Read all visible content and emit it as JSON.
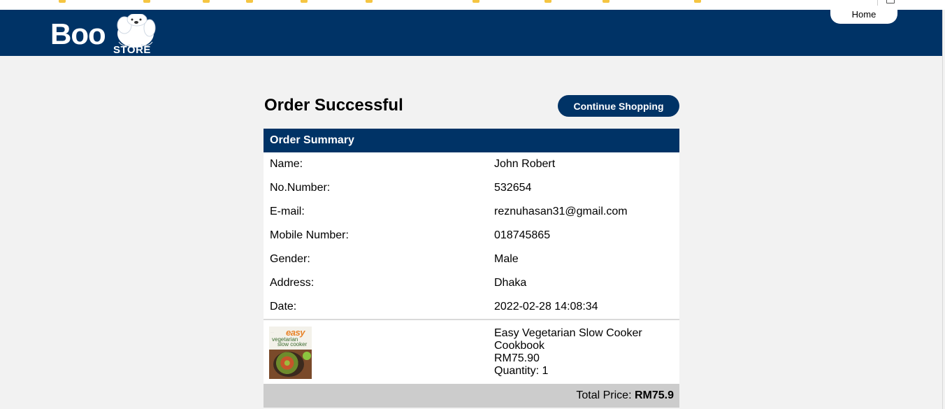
{
  "header": {
    "logo_main": "Boo",
    "logo_sub": "STORE",
    "home_label": "Home"
  },
  "page": {
    "title": "Order Successful",
    "continue_label": "Continue Shopping"
  },
  "summary": {
    "heading": "Order Summary",
    "rows": [
      {
        "label": "Name:",
        "value": "John Robert"
      },
      {
        "label": "No.Number:",
        "value": "532654"
      },
      {
        "label": "E-mail:",
        "value": "reznuhasan31@gmail.com"
      },
      {
        "label": "Mobile Number:",
        "value": "018745865"
      },
      {
        "label": "Gender:",
        "value": "Male"
      },
      {
        "label": "Address:",
        "value": "Dhaka"
      },
      {
        "label": "Date:",
        "value": "2022-02-28 14:08:34"
      }
    ],
    "product": {
      "cover_title": "easy",
      "cover_line2": "vegetarian",
      "cover_line3": "slow cooker",
      "name_line1": "Easy Vegetarian Slow Cooker",
      "name_line2": "Cookbook",
      "price": "RM75.90",
      "quantity": "Quantity: 1"
    },
    "total_label": "Total Price:",
    "total_value": "RM75.9"
  },
  "colors": {
    "brand": "#003366",
    "page_bg": "#f2f2f2",
    "total_bg": "#cccccc"
  }
}
